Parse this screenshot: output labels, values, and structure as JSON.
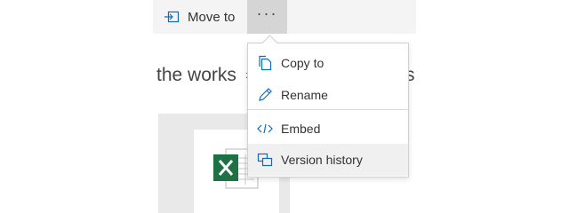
{
  "toolbar": {
    "move_to_label": "Move to",
    "move_to_icon": "move-to-icon",
    "more_icon": "ellipsis-icon",
    "more_label": "···"
  },
  "breadcrumb": {
    "current": "the works",
    "separator": "›",
    "tail": "s"
  },
  "file": {
    "icon": "excel-file-icon",
    "accent": "#1e7145"
  },
  "menu": {
    "items": [
      {
        "label": "Copy to",
        "icon": "copy-icon"
      },
      {
        "label": "Rename",
        "icon": "pencil-icon"
      },
      {
        "label": "Embed",
        "icon": "code-icon"
      },
      {
        "label": "Version history",
        "icon": "version-history-icon",
        "highlighted": true
      }
    ]
  },
  "colors": {
    "icon_blue": "#0f6cbd",
    "menu_hover": "#f0f0f0",
    "command_bar": "#f4f4f4",
    "more_button_active": "#d5d5d5"
  }
}
